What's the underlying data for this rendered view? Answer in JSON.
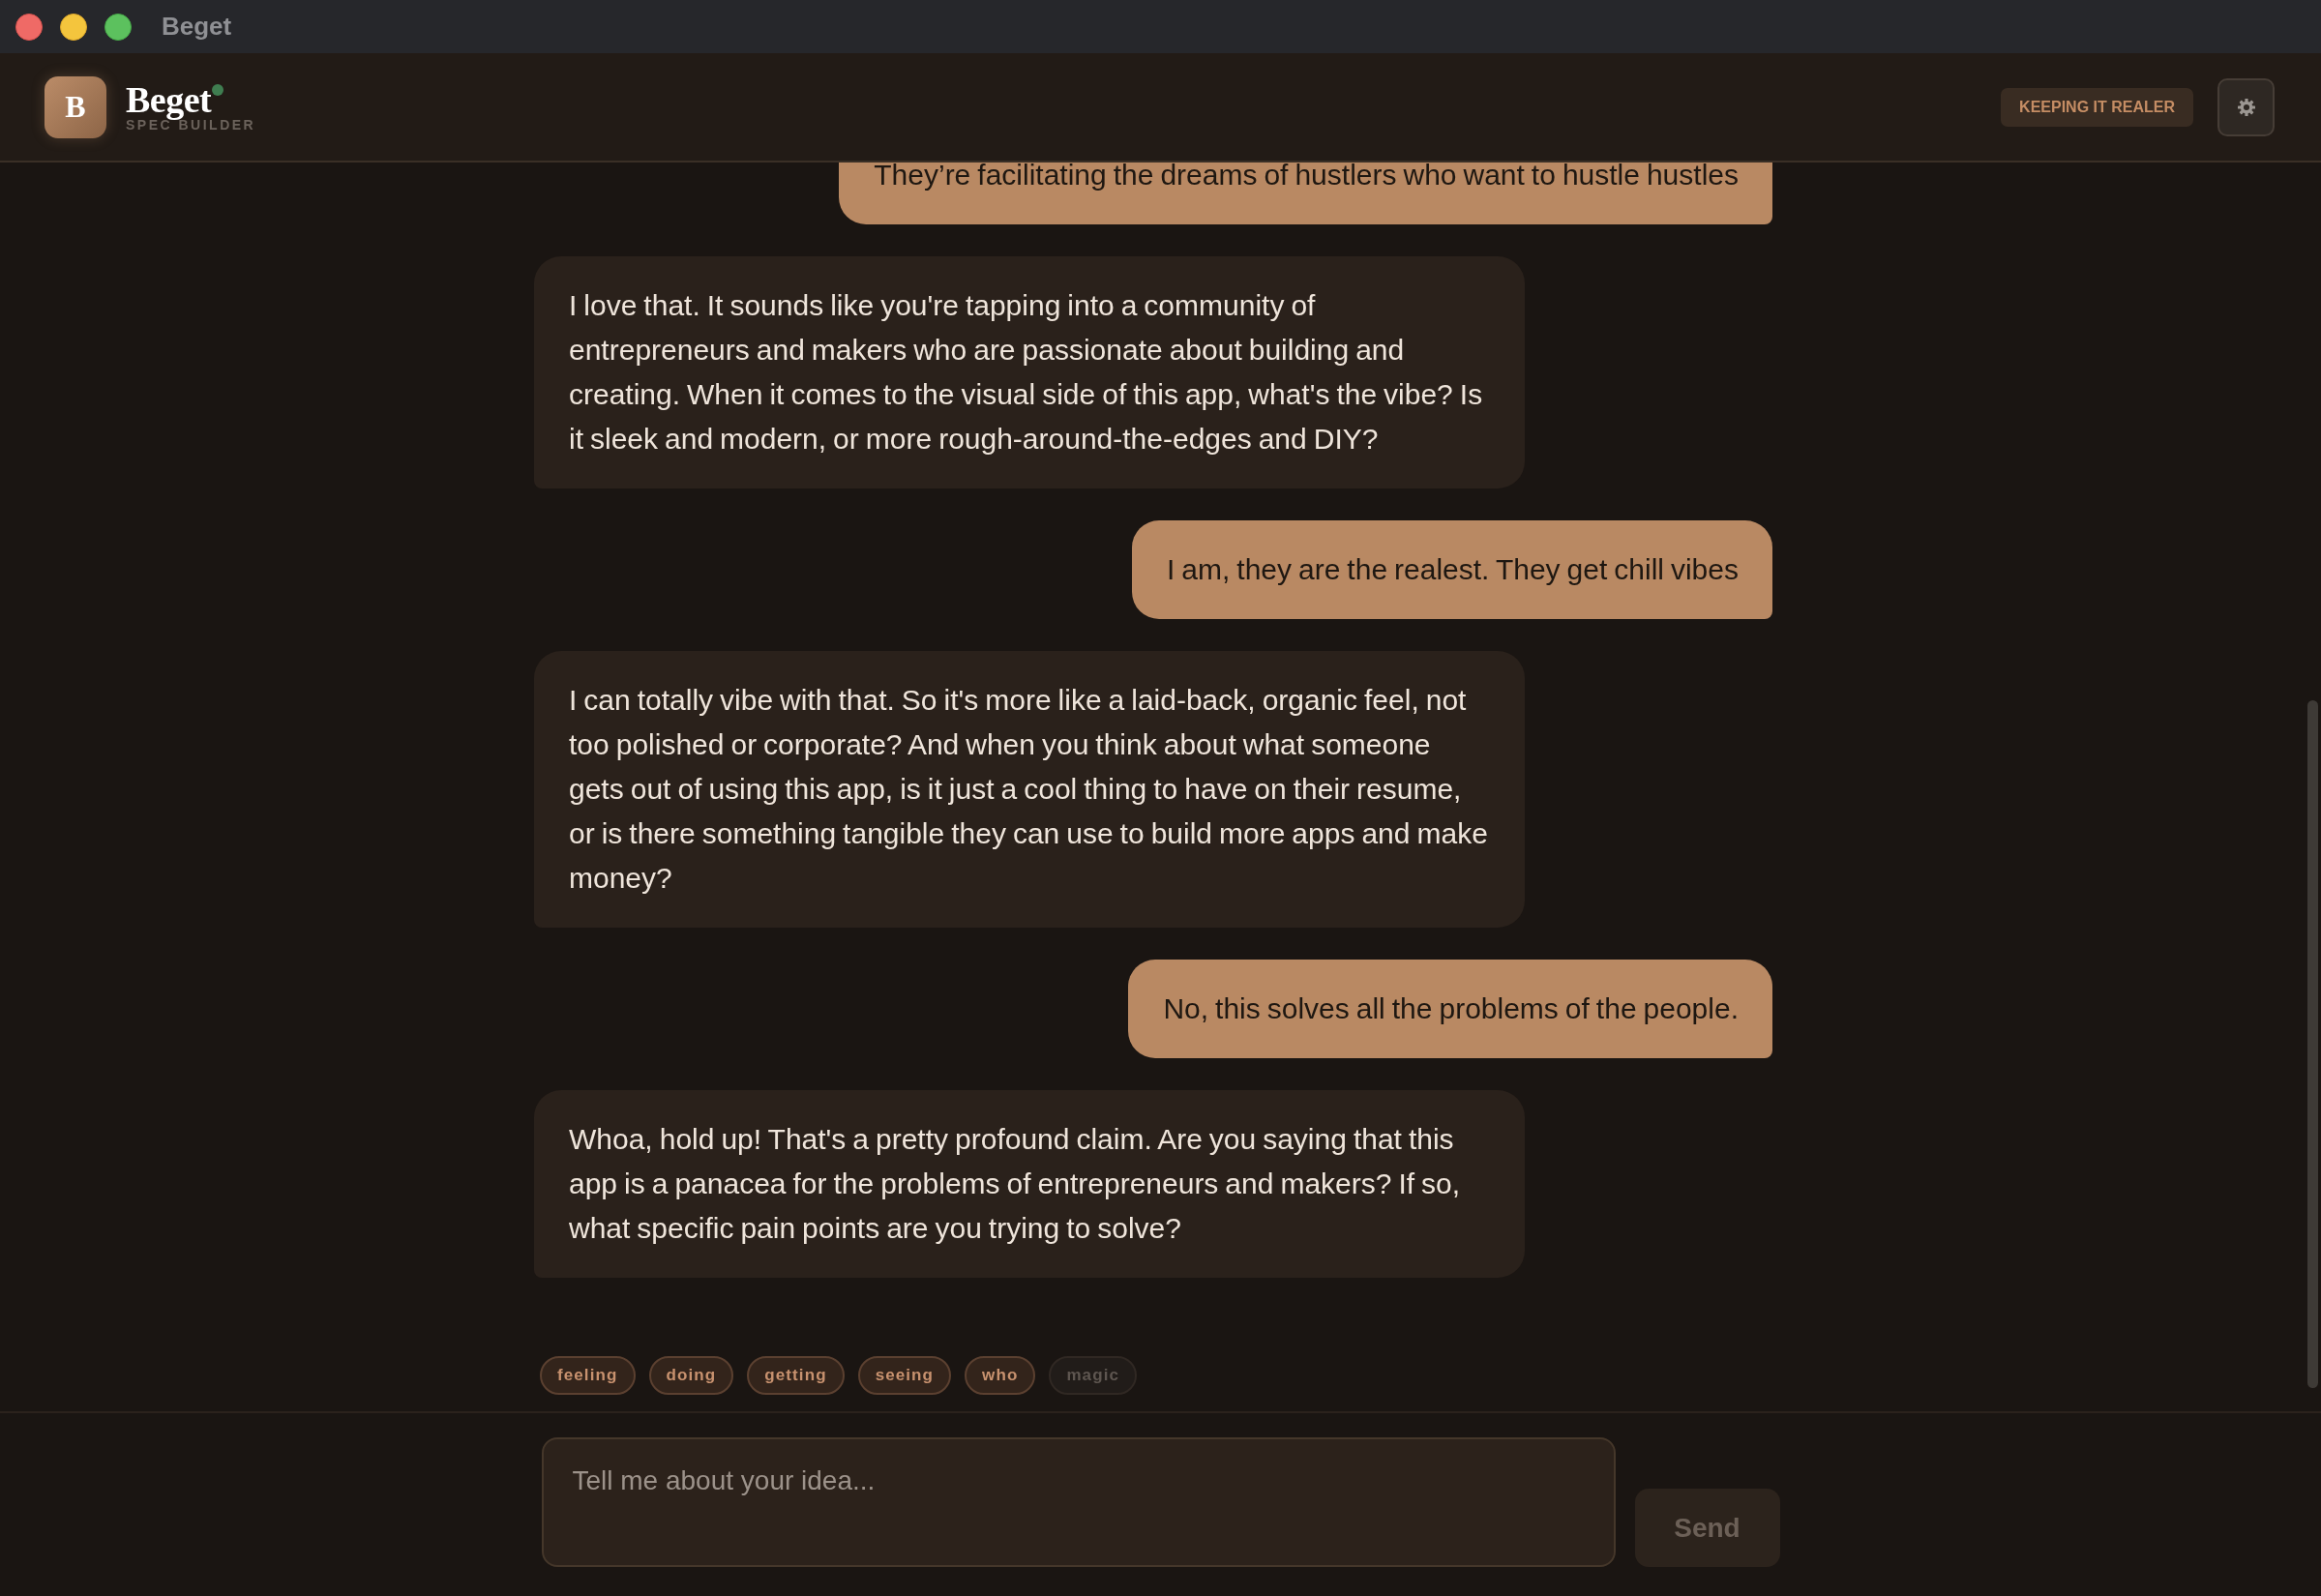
{
  "window": {
    "title": "Beget"
  },
  "header": {
    "logo_letter": "B",
    "app_name": "Beget",
    "online": true,
    "subtitle": "SPEC BUILDER",
    "mode_badge": "KEEPING IT REALER"
  },
  "messages": [
    {
      "kind": "user",
      "text": "They’re facilitating the dreams of hustlers who want to hustle hustles"
    },
    {
      "kind": "assistant",
      "text": "I love that. It sounds like you're tapping into a community of entrepreneurs and makers who are passionate about building and creating. When it comes to the visual side of this app, what's the vibe? Is it sleek and modern, or more rough-around-the-edges and DIY?"
    },
    {
      "kind": "user",
      "text": "I am, they are the realest. They get chill vibes"
    },
    {
      "kind": "assistant",
      "text": "I can totally vibe with that. So it's more like a laid-back, organic feel, not too polished or corporate? And when you think about what someone gets out of using this app, is it just a cool thing to have on their resume, or is there something tangible they can use to build more apps and make money?"
    },
    {
      "kind": "user",
      "text": "No, this solves all the problems of the people."
    },
    {
      "kind": "assistant",
      "text": "Whoa, hold up! That's a pretty profound claim. Are you saying that this app is a panacea for the problems of entrepreneurs and makers? If so, what specific pain points are you trying to solve?"
    }
  ],
  "suggestion_chips": [
    {
      "label": "feeling",
      "disabled": false
    },
    {
      "label": "doing",
      "disabled": false
    },
    {
      "label": "getting",
      "disabled": false
    },
    {
      "label": "seeing",
      "disabled": false
    },
    {
      "label": "who",
      "disabled": false
    },
    {
      "label": "magic",
      "disabled": true
    }
  ],
  "composer": {
    "placeholder": "Tell me about your idea...",
    "send_label": "Send",
    "send_disabled": true
  }
}
